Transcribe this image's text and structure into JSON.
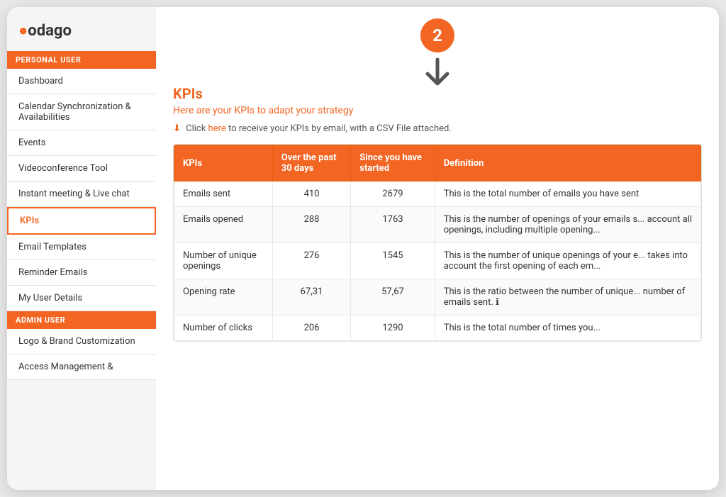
{
  "app": {
    "logo": "odago",
    "logo_dot": "●"
  },
  "sidebar": {
    "personal_user_label": "PERSONAL USER",
    "admin_user_label": "ADMIN USER",
    "items_personal": [
      {
        "id": "dashboard",
        "label": "Dashboard",
        "active": false
      },
      {
        "id": "calendar-sync",
        "label": "Calendar Synchronization & Availabilities",
        "active": false
      },
      {
        "id": "events",
        "label": "Events",
        "active": false
      },
      {
        "id": "videoconference",
        "label": "Videoconference Tool",
        "active": false
      },
      {
        "id": "instant-meeting",
        "label": "Instant meeting & Live chat",
        "active": false
      },
      {
        "id": "kpis",
        "label": "KPIs",
        "active": true
      },
      {
        "id": "email-templates",
        "label": "Email Templates",
        "active": false
      },
      {
        "id": "reminder-emails",
        "label": "Reminder Emails",
        "active": false
      },
      {
        "id": "my-user-details",
        "label": "My User Details",
        "active": false
      }
    ],
    "items_admin": [
      {
        "id": "logo-brand",
        "label": "Logo & Brand Customization",
        "active": false
      },
      {
        "id": "access-management",
        "label": "Access Management &",
        "active": false
      }
    ]
  },
  "main": {
    "step_number": "2",
    "kpi_title": "KPIs",
    "kpi_subtitle": "Here are your KPIs to adapt your strategy",
    "email_line_prefix": " Click ",
    "email_link_text": "here",
    "email_line_suffix": " to receive your KPIs by email, with a CSV File attached.",
    "table": {
      "headers": [
        "KPIs",
        "Over the past 30 days",
        "Since you have started",
        "Definition"
      ],
      "rows": [
        {
          "kpi": "Emails sent",
          "past30": "410",
          "since_start": "2679",
          "definition": "This is the total number of emails you have sent"
        },
        {
          "kpi": "Emails opened",
          "past30": "288",
          "since_start": "1763",
          "definition": "This is the number of openings of your emails s... account all openings, including multiple opening..."
        },
        {
          "kpi": "Number of unique openings",
          "past30": "276",
          "since_start": "1545",
          "definition": "This is the number of unique openings of your e... takes into account the first opening of each em..."
        },
        {
          "kpi": "Opening rate",
          "past30": "67,31",
          "since_start": "57,67",
          "definition": "This is the ratio between the number of unique... number of emails sent. ℹ"
        },
        {
          "kpi": "Number of clicks",
          "past30": "206",
          "since_start": "1290",
          "definition": "This is the total number of times you..."
        }
      ]
    }
  }
}
